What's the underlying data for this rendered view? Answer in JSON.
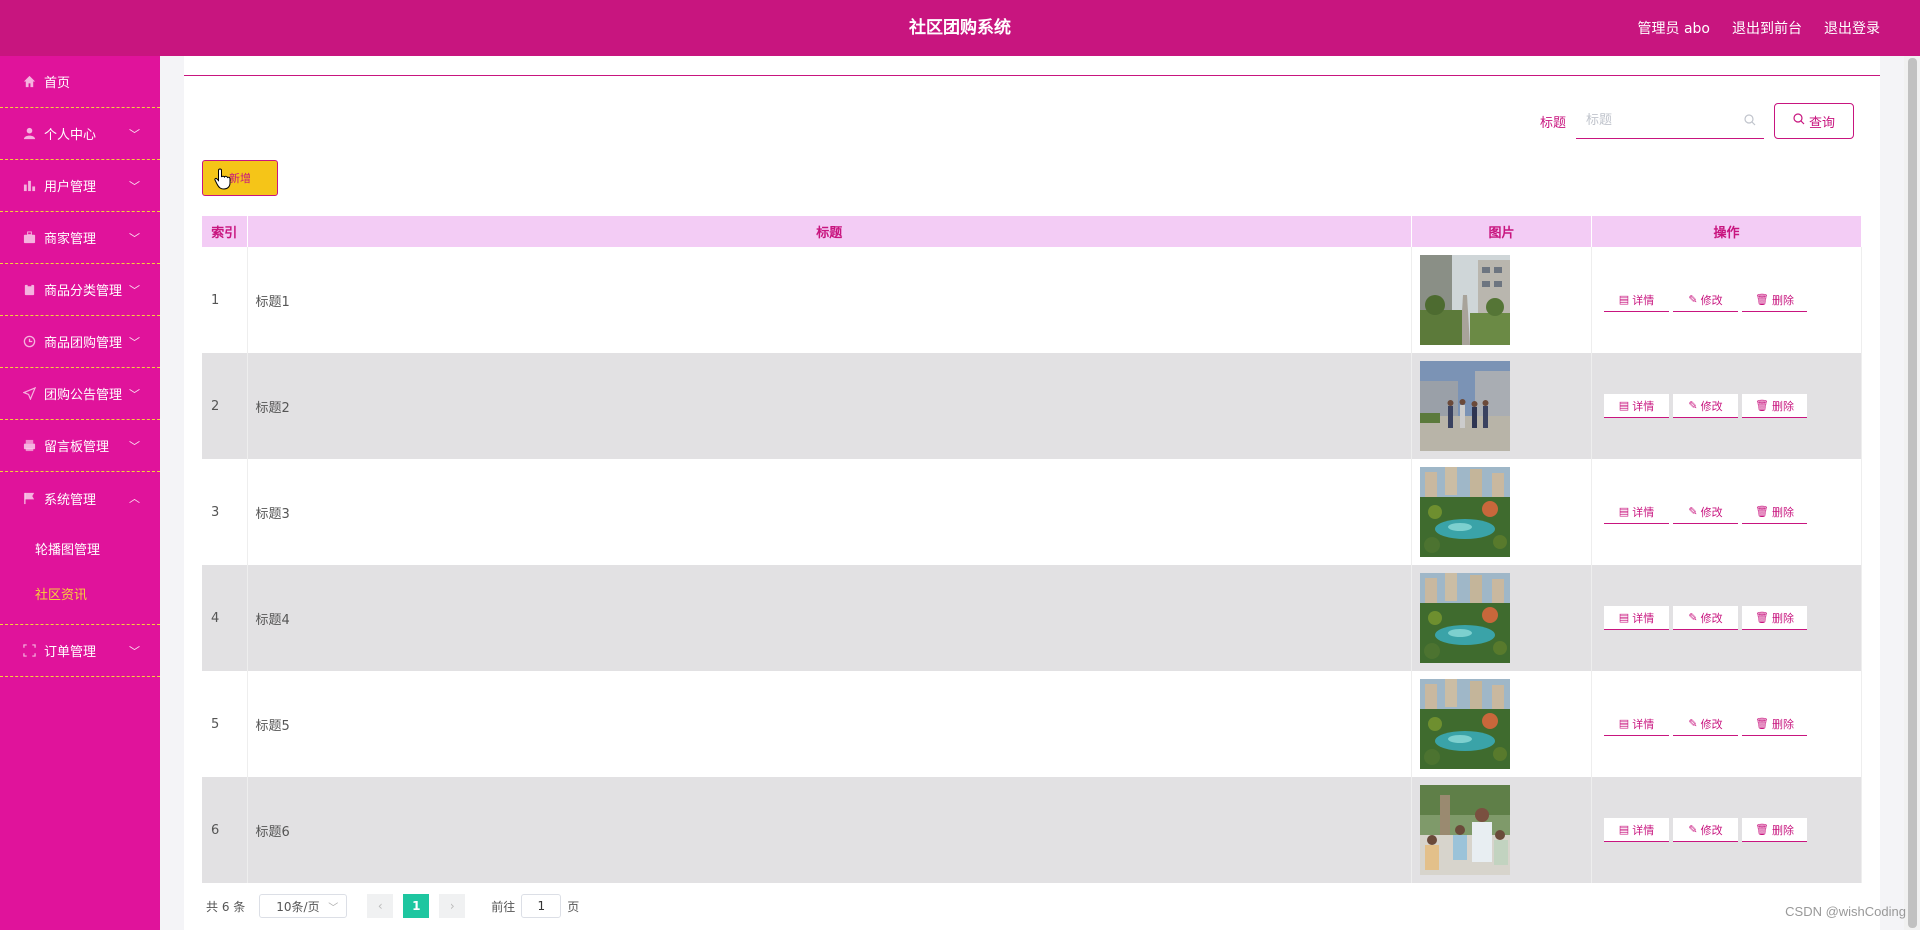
{
  "header": {
    "title": "社区团购系统",
    "admin": "管理员 abo",
    "to_front": "退出到前台",
    "logout": "退出登录"
  },
  "sidebar": {
    "items": [
      {
        "label": "首页",
        "icon": "home-icon",
        "has_arrow": false
      },
      {
        "label": "个人中心",
        "icon": "user-icon",
        "has_arrow": true
      },
      {
        "label": "用户管理",
        "icon": "chart-icon",
        "has_arrow": true
      },
      {
        "label": "商家管理",
        "icon": "briefcase-icon",
        "has_arrow": true
      },
      {
        "label": "商品分类管理",
        "icon": "clipboard-icon",
        "has_arrow": true
      },
      {
        "label": "商品团购管理",
        "icon": "clock-icon",
        "has_arrow": true
      },
      {
        "label": "团购公告管理",
        "icon": "send-icon",
        "has_arrow": true
      },
      {
        "label": "留言板管理",
        "icon": "printer-icon",
        "has_arrow": true
      },
      {
        "label": "系统管理",
        "icon": "flag-icon",
        "has_arrow": true,
        "expanded": true
      },
      {
        "label": "订单管理",
        "icon": "fullscreen-icon",
        "has_arrow": true
      }
    ],
    "system_sub": [
      "轮播图管理",
      "社区资讯"
    ],
    "active_sub": "社区资讯"
  },
  "search": {
    "label": "标题",
    "placeholder": "标题",
    "button": "查询"
  },
  "add_button": "新增",
  "table": {
    "headers": [
      "索引",
      "标题",
      "图片",
      "操作"
    ],
    "rows": [
      {
        "index": "1",
        "title": "标题1",
        "image": "residential-street"
      },
      {
        "index": "2",
        "title": "标题2",
        "image": "people-walking"
      },
      {
        "index": "3",
        "title": "标题3",
        "image": "garden-aerial"
      },
      {
        "index": "4",
        "title": "标题4",
        "image": "garden-aerial"
      },
      {
        "index": "5",
        "title": "标题5",
        "image": "garden-aerial"
      },
      {
        "index": "6",
        "title": "标题6",
        "image": "crowd-outdoor"
      }
    ],
    "actions": {
      "detail": "详情",
      "edit": "修改",
      "delete": "删除"
    }
  },
  "pager": {
    "total": "共 6 条",
    "page_size": "10条/页",
    "current_page": "1",
    "goto_label": "前往",
    "goto_value": "1",
    "page_suffix": "页"
  },
  "watermark": "CSDN @wishCoding",
  "colors": {
    "primary": "#c8157f",
    "sidebar": "#e0139b",
    "divider": "#f5d23a",
    "add_button": "#f5c518",
    "header_row": "#f3ccf5",
    "pager_active": "#1ec6a0"
  }
}
